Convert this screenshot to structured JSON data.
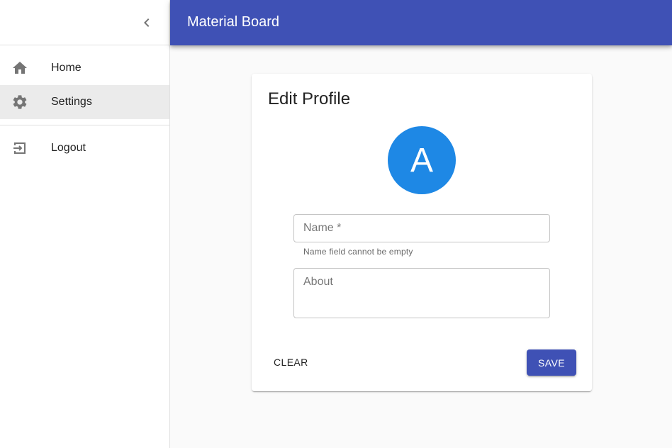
{
  "app": {
    "title": "Material Board"
  },
  "drawer": {
    "collapse_icon": "chevron-left-icon",
    "items": [
      {
        "label": "Home",
        "icon": "home-icon",
        "selected": false
      },
      {
        "label": "Settings",
        "icon": "gear-icon",
        "selected": true
      }
    ],
    "secondary_items": [
      {
        "label": "Logout",
        "icon": "logout-icon"
      }
    ]
  },
  "profile": {
    "title": "Edit Profile",
    "avatar_initial": "A",
    "avatar_color": "#1e88e5",
    "name_field": {
      "label": "Name *",
      "value": "",
      "helper": "Name field cannot be empty"
    },
    "about_field": {
      "label": "About",
      "value": ""
    },
    "clear_label": "CLEAR",
    "save_label": "SAVE"
  },
  "colors": {
    "primary": "#3f51b5",
    "background": "#fafafa"
  }
}
